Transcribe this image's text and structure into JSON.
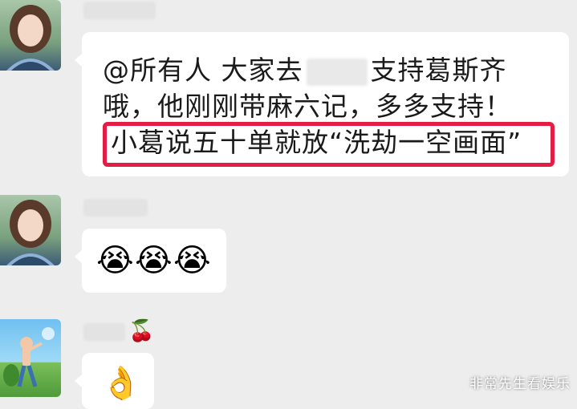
{
  "messages": [
    {
      "lines": [
        "@所有人  大家去",
        "支持葛斯齐",
        "哦，他刚刚带麻六记，多多支持！",
        "小葛说五十单就放“洗劫一空画面”"
      ]
    },
    {
      "emojis": [
        "😭",
        "😭",
        "😭"
      ]
    },
    {
      "reaction": "🍒",
      "emoji": "👌"
    }
  ],
  "highlight_color": "#e21e47",
  "watermark": "非常先生看娱乐"
}
